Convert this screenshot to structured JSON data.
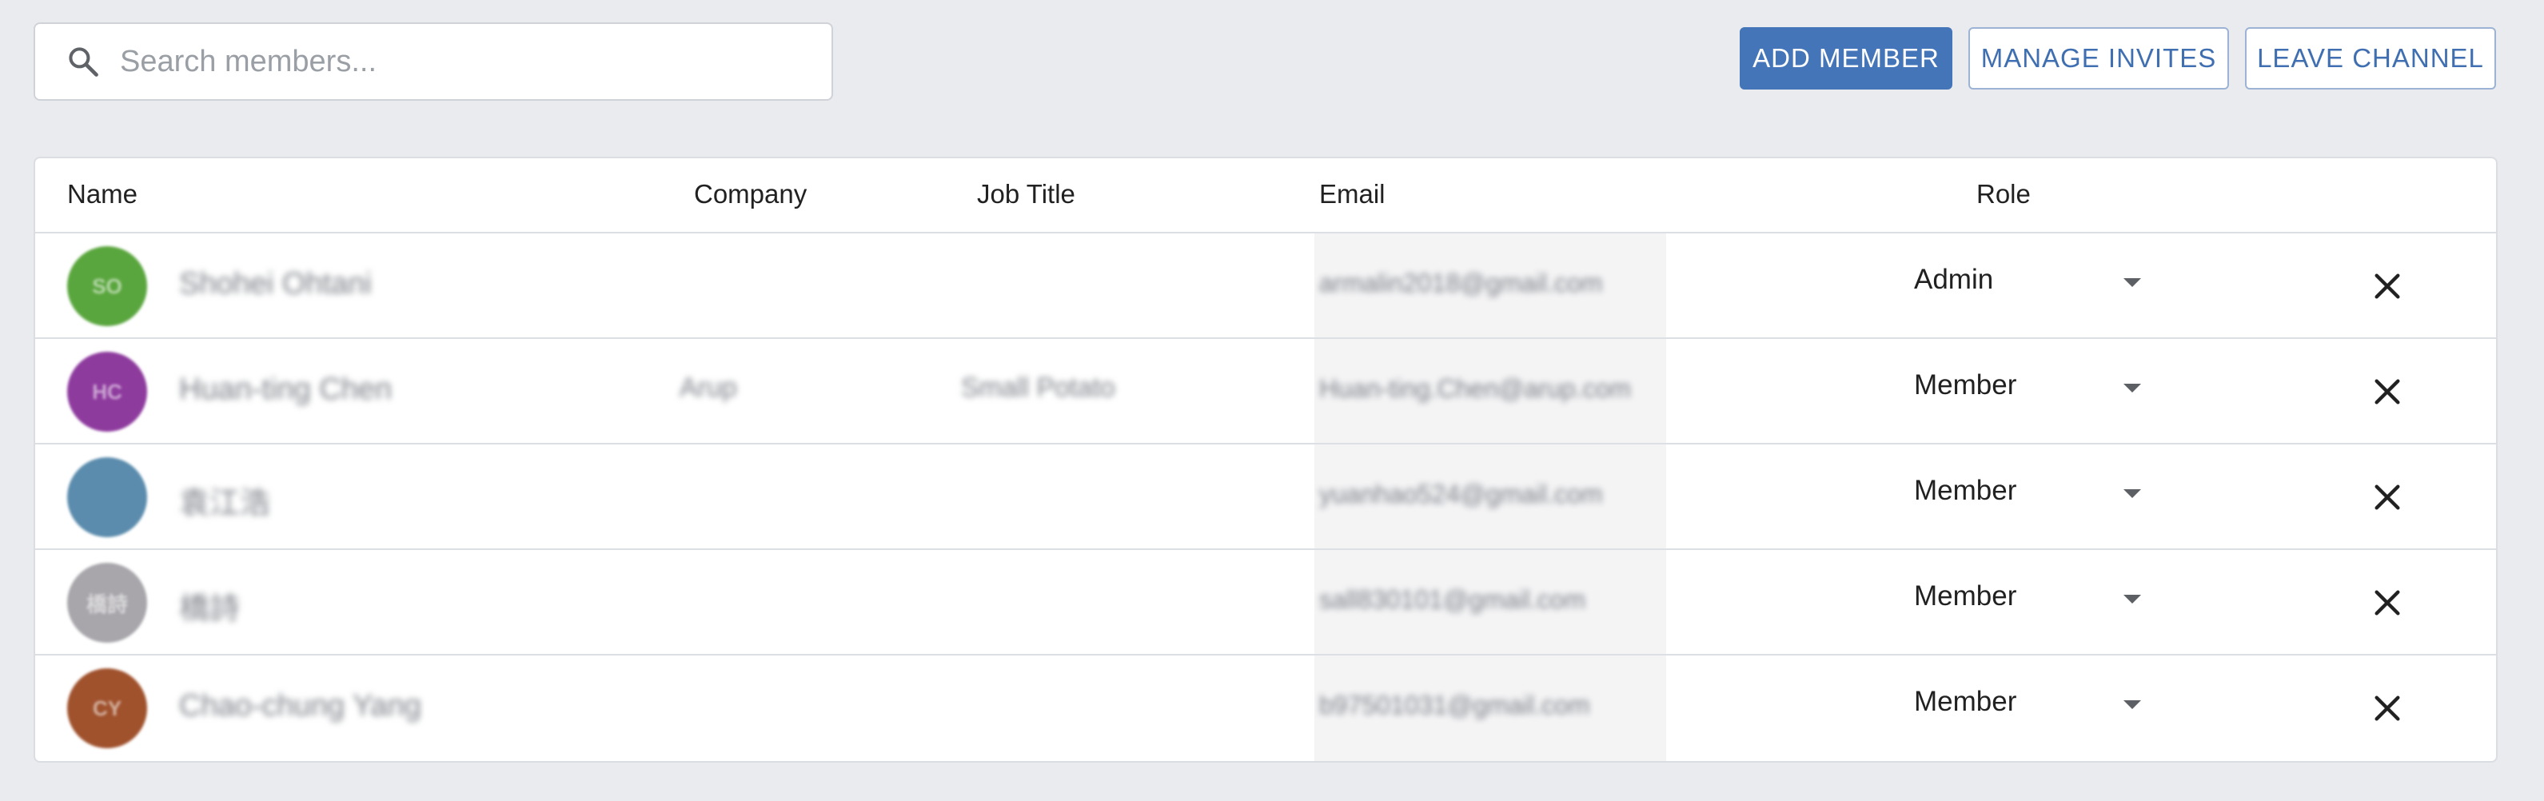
{
  "search": {
    "placeholder": "Search members...",
    "value": "",
    "icon": "search-icon"
  },
  "toolbar": {
    "add_member": "ADD MEMBER",
    "manage_invites": "MANAGE INVITES",
    "leave_channel": "LEAVE CHANNEL"
  },
  "colors": {
    "primary": "#4475b8",
    "background": "#e9ebef"
  },
  "table": {
    "headers": {
      "name": "Name",
      "company": "Company",
      "job_title": "Job Title",
      "email": "Email",
      "role": "Role"
    },
    "rows": [
      {
        "initials": "SO",
        "avatar_color": "#5aa63e",
        "name": "Shohei Ohtani",
        "company": "",
        "job_title": "",
        "email": "armalin2018@gmail.com",
        "role": "Admin"
      },
      {
        "initials": "HC",
        "avatar_color": "#8e3b9e",
        "name": "Huan-ting Chen",
        "company": "Arup",
        "job_title": "Small Potato",
        "email": "Huan-ting.Chen@arup.com",
        "role": "Member"
      },
      {
        "initials": "",
        "avatar_color": "#5b8cad",
        "name": "袁江浩",
        "company": "",
        "job_title": "",
        "email": "yuanhao524@gmail.com",
        "role": "Member"
      },
      {
        "initials": "橋詩",
        "avatar_color": "#a8a6ab",
        "name": "橋詩",
        "company": "",
        "job_title": "",
        "email": "sall830101@gmail.com",
        "role": "Member"
      },
      {
        "initials": "CY",
        "avatar_color": "#a0522d",
        "name": "Chao-chung Yang",
        "company": "",
        "job_title": "",
        "email": "b97501031@gmail.com",
        "role": "Member"
      }
    ]
  }
}
